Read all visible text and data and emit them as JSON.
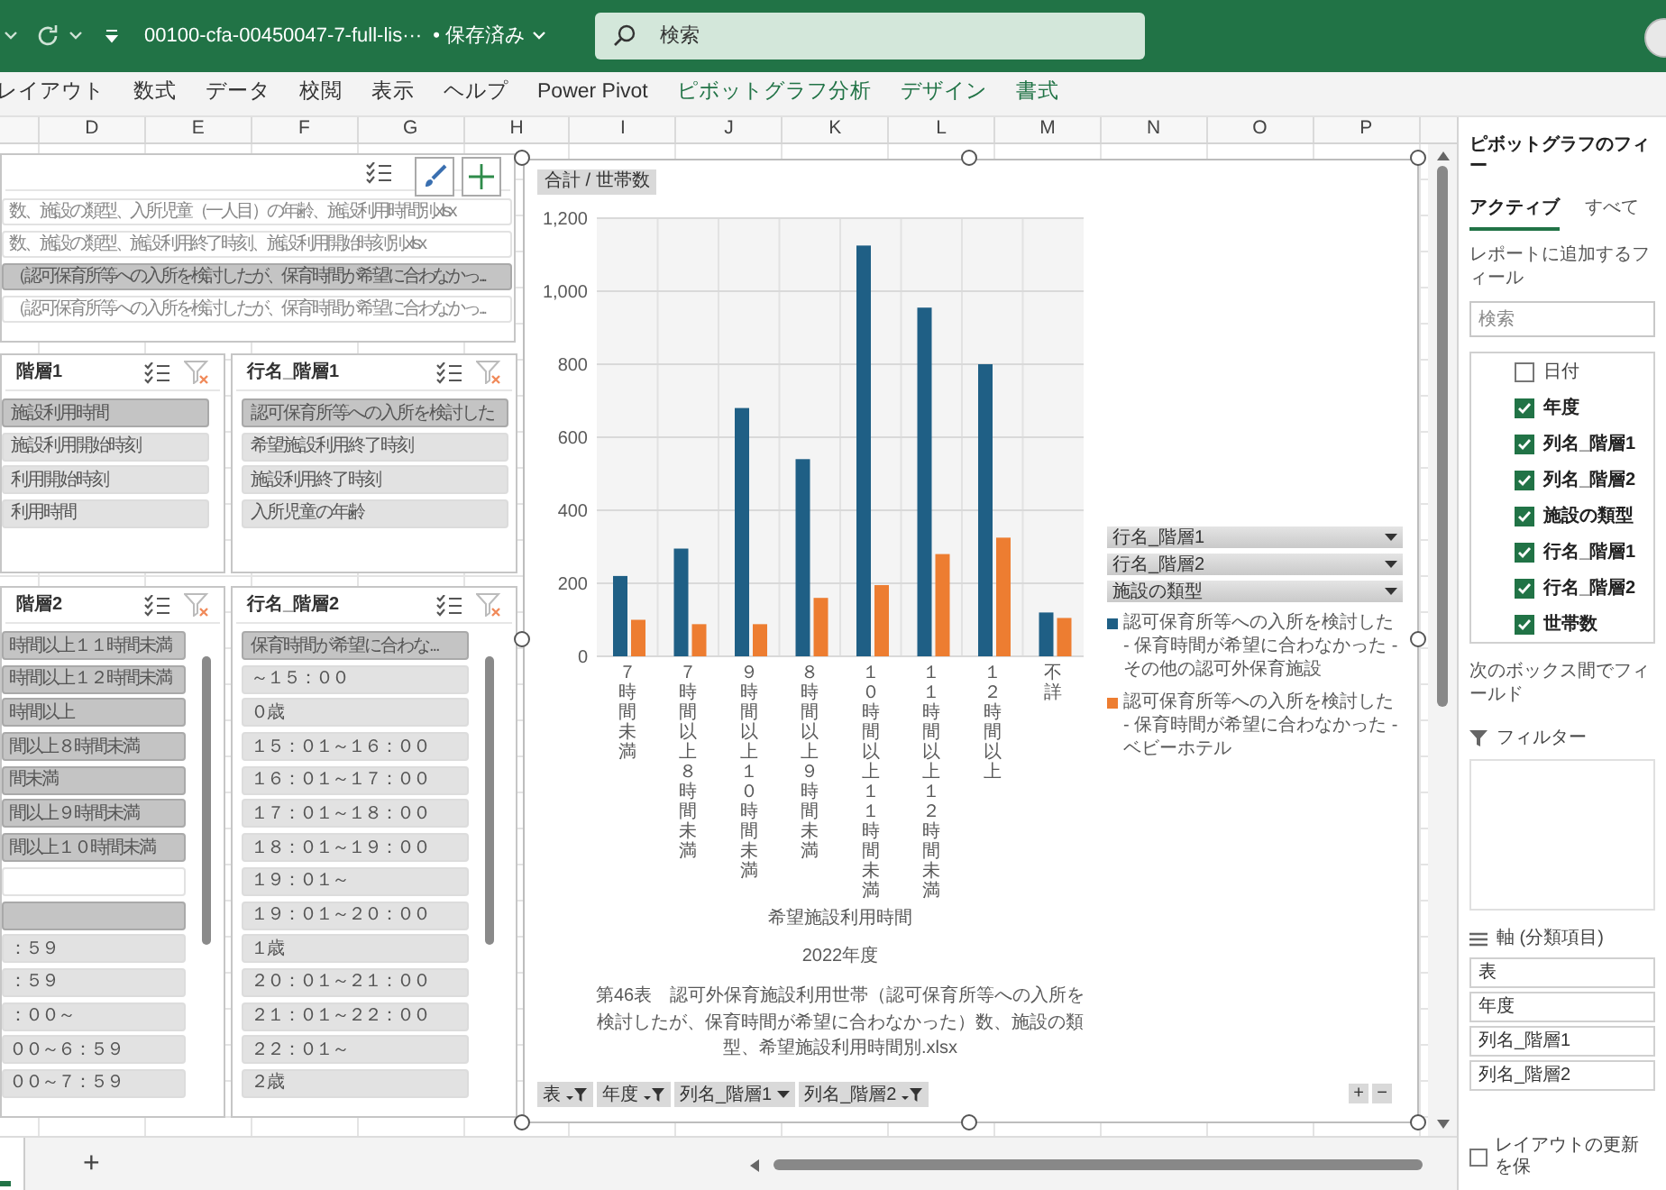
{
  "title_bar": {
    "file_name": "00100-cfa-00450047-7-full-lis···",
    "save_status": "• 保存済み",
    "search": {
      "placeholder": "検索"
    }
  },
  "ribbon_tabs": [
    {
      "label": "レイアウト",
      "contextual": false
    },
    {
      "label": "数式",
      "contextual": false
    },
    {
      "label": "データ",
      "contextual": false
    },
    {
      "label": "校閲",
      "contextual": false
    },
    {
      "label": "表示",
      "contextual": false
    },
    {
      "label": "ヘルプ",
      "contextual": false
    },
    {
      "label": "Power Pivot",
      "contextual": false
    },
    {
      "label": "ピボットグラフ分析",
      "contextual": true
    },
    {
      "label": "デザイン",
      "contextual": true
    },
    {
      "label": "書式",
      "contextual": true
    }
  ],
  "columns": [
    "D",
    "E",
    "F",
    "G",
    "H",
    "I",
    "J",
    "K",
    "L",
    "M",
    "N",
    "O",
    "P"
  ],
  "slicers": [
    {
      "items": [
        {
          "label": "数、施設の類型、入所児童（一人目）の年齢、施設利用時間別.xlsx",
          "selected": false,
          "available": false
        },
        {
          "label": "数、施設の類型、施設利用終了時刻、施設利用開始時刻別.xlsx",
          "selected": false,
          "available": false
        },
        {
          "label": "（認可保育所等への入所を検討したが、保育時間が希望に合わなかっ...",
          "selected": true,
          "available": true
        },
        {
          "label": "（認可保育所等への入所を検討したが、保育時間が希望に合わなかっ...",
          "selected": false,
          "available": false
        }
      ]
    },
    {
      "title": "階層1",
      "items": [
        {
          "label": "施設利用時間",
          "selected": true,
          "available": true
        },
        {
          "label": "施設利用開始時刻",
          "selected": false,
          "available": true
        },
        {
          "label": "利用開始時刻",
          "selected": false,
          "available": true
        },
        {
          "label": "利用時間",
          "selected": false,
          "available": true
        }
      ]
    },
    {
      "title": "行名_階層1",
      "items": [
        {
          "label": "認可保育所等への入所を検討した",
          "selected": true,
          "available": true
        },
        {
          "label": "希望施設利用終了時刻",
          "selected": false,
          "available": true
        },
        {
          "label": "施設利用終了時刻",
          "selected": false,
          "available": true
        },
        {
          "label": "入所児童の年齢",
          "selected": false,
          "available": true
        }
      ]
    },
    {
      "title": "階層2",
      "items": [
        {
          "label": "時間以上１１時間未満",
          "selected": true,
          "available": true
        },
        {
          "label": "時間以上１２時間未満",
          "selected": true,
          "available": true
        },
        {
          "label": "時間以上",
          "selected": true,
          "available": true
        },
        {
          "label": "間以上８時間未満",
          "selected": true,
          "available": true
        },
        {
          "label": "間未満",
          "selected": true,
          "available": true
        },
        {
          "label": "間以上９時間未満",
          "selected": true,
          "available": true
        },
        {
          "label": "間以上１０時間未満",
          "selected": true,
          "available": true
        },
        {
          "selected": false,
          "available": false
        },
        {
          "selected": true,
          "available": true
        },
        {
          "label": "：５９",
          "selected": false,
          "available": true
        },
        {
          "label": "：５９",
          "selected": false,
          "available": true
        },
        {
          "label": "：００～",
          "selected": false,
          "available": true
        },
        {
          "label": "００～６：５９",
          "selected": false,
          "available": true
        },
        {
          "label": "００～７：５９",
          "selected": false,
          "available": true
        }
      ]
    },
    {
      "title": "行名_階層2",
      "items": [
        {
          "label": "保育時間が希望に合わな...",
          "selected": true,
          "available": true
        },
        {
          "label": "～１５：００",
          "selected": false,
          "available": true
        },
        {
          "label": "０歳",
          "selected": false,
          "available": true
        },
        {
          "label": "１５：０１～１６：００",
          "selected": false,
          "available": true
        },
        {
          "label": "１６：０１～１７：００",
          "selected": false,
          "available": true
        },
        {
          "label": "１７：０１～１８：００",
          "selected": false,
          "available": true
        },
        {
          "label": "１８：０１～１９：００",
          "selected": false,
          "available": true
        },
        {
          "label": "１９：０１～",
          "selected": false,
          "available": true
        },
        {
          "label": "１９：０１～２０：００",
          "selected": false,
          "available": true
        },
        {
          "label": "１歳",
          "selected": false,
          "available": true
        },
        {
          "label": "２０：０１～２１：００",
          "selected": false,
          "available": true
        },
        {
          "label": "２１：０１～２２：００",
          "selected": false,
          "available": true
        },
        {
          "label": "２２：０１～",
          "selected": false,
          "available": true
        },
        {
          "label": "２歳",
          "selected": false,
          "available": true
        }
      ]
    }
  ],
  "chart": {
    "value_button": "合計 / 世帯数",
    "legend_buttons": [
      "行名_階層1",
      "行名_階層2",
      "施設の類型"
    ],
    "axis_buttons": [
      "表",
      "年度",
      "列名_階層1",
      "列名_階層2"
    ],
    "zoom_buttons": [
      "+",
      "−"
    ],
    "outer_labels": [
      "希望施設利用時間",
      "2022年度",
      "第46表　認可外保育施設利用世帯（認可保育所等への入所を検討したが、保育時間が希望に合わなかった）数、施設の類型、希望施設利用時間別.xlsx"
    ],
    "chart_data": {
      "type": "bar",
      "categories": [
        "７時間未満",
        "７時間以上８時間未満",
        "９時間以上１０時間未満",
        "８時間以上９時間未満",
        "１０時間以上１１時間未満",
        "１１時間以上１２時間未満",
        "１２時間以上",
        "不詳"
      ],
      "series": [
        {
          "name": "認可保育所等への入所を検討した - 保育時間が希望に合わなかった - その他の認可外保育施設",
          "color": "#1f5f85",
          "values": [
            220,
            295,
            680,
            540,
            1125,
            955,
            800,
            120
          ]
        },
        {
          "name": "認可保育所等への入所を検討した - 保育時間が希望に合わなかった - ベビーホテル",
          "color": "#ed7d31",
          "values": [
            100,
            88,
            88,
            160,
            195,
            280,
            325,
            105
          ]
        }
      ],
      "grid": true,
      "legend": "right",
      "ylim": [
        0,
        1200
      ],
      "yticks": [
        0,
        200,
        400,
        600,
        800,
        {
          "value": 1000,
          "label": "1,000"
        },
        {
          "value": 1200,
          "label": "1,200"
        }
      ]
    }
  },
  "field_pane": {
    "title": "ピボットグラフのフィー",
    "tabs": [
      {
        "label": "アクティブ",
        "selected": true
      },
      {
        "label": "すべて",
        "selected": false
      }
    ],
    "instruction": "レポートに追加するフィール",
    "search": {
      "placeholder": "検索"
    },
    "fields": [
      {
        "label": "日付",
        "checked": false
      },
      {
        "label": "年度",
        "checked": true
      },
      {
        "label": "列名_階層1",
        "checked": true
      },
      {
        "label": "列名_階層2",
        "checked": true
      },
      {
        "label": "施設の類型",
        "checked": true
      },
      {
        "label": "行名_階層1",
        "checked": true
      },
      {
        "label": "行名_階層2",
        "checked": true
      },
      {
        "label": "世帯数",
        "checked": true
      }
    ],
    "areas_hint": "次のボックス間でフィールド",
    "filter_area": {
      "label": "フィルター"
    },
    "axis_area": {
      "label": "軸 (分類項目)",
      "items": [
        "表",
        "年度",
        "列名_階層1",
        "列名_階層2"
      ]
    },
    "defer_update": {
      "label": "レイアウトの更新を保",
      "checked": false
    }
  },
  "sheet_bar": {
    "add_button": "+"
  }
}
